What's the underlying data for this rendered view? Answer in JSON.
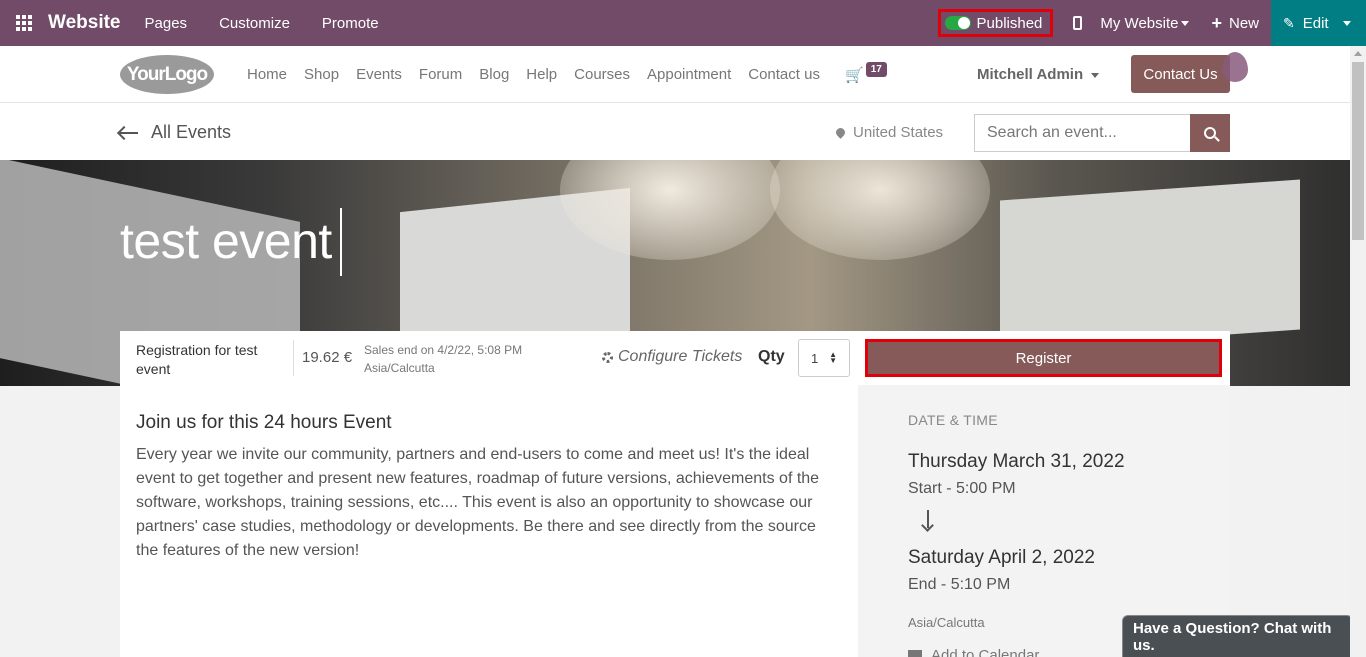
{
  "topbar": {
    "brand": "Website",
    "menus": [
      "Pages",
      "Customize",
      "Promote"
    ],
    "published_label": "Published",
    "my_website_label": "My Website",
    "new_label": "New",
    "edit_label": "Edit"
  },
  "header": {
    "logo_text": "YourLogo",
    "nav": [
      "Home",
      "Shop",
      "Events",
      "Forum",
      "Blog",
      "Help",
      "Courses",
      "Appointment",
      "Contact us"
    ],
    "cart_count": "17",
    "user_name": "Mitchell Admin",
    "contact_label": "Contact Us"
  },
  "subbar": {
    "back_label": "All Events",
    "location": "United States",
    "search_placeholder": "Search an event..."
  },
  "hero": {
    "title": "test event"
  },
  "ticket": {
    "name": "Registration for test event",
    "price": "19.62 €",
    "sales_end": "Sales end on 4/2/22, 5:08 PM",
    "timezone": "Asia/Calcutta",
    "configure_label": "Configure Tickets",
    "qty_label": "Qty",
    "qty_value": "1",
    "register_label": "Register"
  },
  "content": {
    "title": "Join us for this 24 hours Event",
    "body": "Every year we invite our community, partners and end-users to come and meet us! It's the ideal event to get together and present new features, roadmap of future versions, achievements of the software, workshops, training sessions, etc.... This event is also an opportunity to showcase our partners' case studies, methodology or developments. Be there and see directly from the source the features of the new version!"
  },
  "sidebar": {
    "heading": "DATE & TIME",
    "start_date": "Thursday March 31, 2022",
    "start_time": "Start - 5:00 PM",
    "end_date": "Saturday April 2, 2022",
    "end_time": "End - 5:10 PM",
    "timezone": "Asia/Calcutta",
    "calendar_label": "Add to Calendar"
  },
  "chat": {
    "label": "Have a Question? Chat with us."
  },
  "colors": {
    "topbar": "#714b67",
    "edit": "#017e84",
    "primary": "#875a5a",
    "highlight": "#e0000a"
  },
  "icons": [
    "apps-grid-icon",
    "toggle-icon",
    "mobile-icon",
    "plus-icon",
    "pencil-icon",
    "cart-icon",
    "map-pin-icon",
    "search-icon",
    "gear-icon",
    "arrow-down-icon",
    "calendar-icon"
  ]
}
